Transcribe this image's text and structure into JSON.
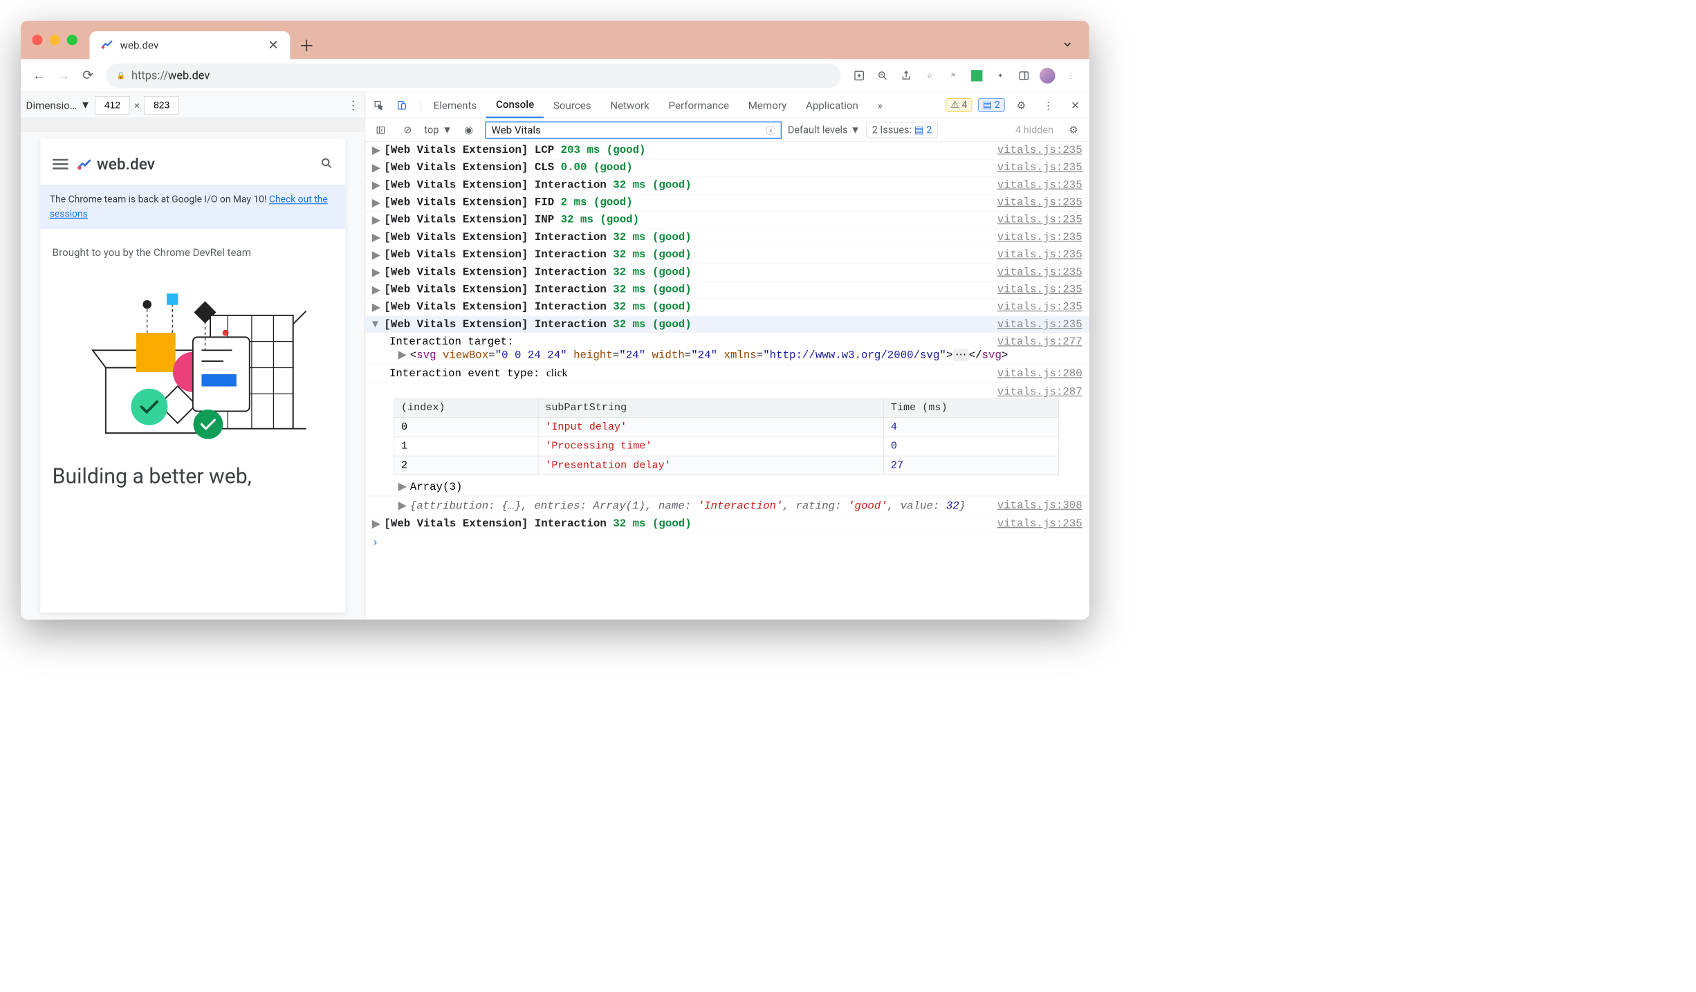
{
  "browser": {
    "tab_title": "web.dev",
    "url_scheme": "https://",
    "url_host": "web.dev",
    "dimensions_label": "Dimensio…",
    "width": "412",
    "height": "823"
  },
  "page": {
    "logo_text": "web.dev",
    "banner_text": "The Chrome team is back at Google I/O on May 10! ",
    "banner_link": "Check out the sessions",
    "subhead": "Brought to you by the Chrome DevRel team",
    "headline": "Building a better web,"
  },
  "devtools": {
    "tabs": [
      "Elements",
      "Console",
      "Sources",
      "Network",
      "Performance",
      "Memory",
      "Application"
    ],
    "active_tab": "Console",
    "warn_count": "4",
    "info_count": "2",
    "context": "top",
    "filter_value": "Web Vitals",
    "levels_label": "Default levels",
    "issues_label": "2 Issues:",
    "issues_count": "2",
    "hidden_label": "4 hidden"
  },
  "logs": [
    {
      "prefix": "[Web Vitals Extension]",
      "metric": "LCP",
      "value": "203 ms (good)",
      "src": "vitals.js:235"
    },
    {
      "prefix": "[Web Vitals Extension]",
      "metric": "CLS",
      "value": "0.00 (good)",
      "src": "vitals.js:235"
    },
    {
      "prefix": "[Web Vitals Extension]",
      "metric": "Interaction",
      "value": "32 ms (good)",
      "src": "vitals.js:235"
    },
    {
      "prefix": "[Web Vitals Extension]",
      "metric": "FID",
      "value": "2 ms (good)",
      "src": "vitals.js:235"
    },
    {
      "prefix": "[Web Vitals Extension]",
      "metric": "INP",
      "value": "32 ms (good)",
      "src": "vitals.js:235"
    },
    {
      "prefix": "[Web Vitals Extension]",
      "metric": "Interaction",
      "value": "32 ms (good)",
      "src": "vitals.js:235"
    },
    {
      "prefix": "[Web Vitals Extension]",
      "metric": "Interaction",
      "value": "32 ms (good)",
      "src": "vitals.js:235"
    },
    {
      "prefix": "[Web Vitals Extension]",
      "metric": "Interaction",
      "value": "32 ms (good)",
      "src": "vitals.js:235"
    },
    {
      "prefix": "[Web Vitals Extension]",
      "metric": "Interaction",
      "value": "32 ms (good)",
      "src": "vitals.js:235"
    },
    {
      "prefix": "[Web Vitals Extension]",
      "metric": "Interaction",
      "value": "32 ms (good)",
      "src": "vitals.js:235"
    }
  ],
  "expanded": {
    "head": {
      "prefix": "[Web Vitals Extension]",
      "metric": "Interaction",
      "value": "32 ms (good)",
      "src": "vitals.js:235"
    },
    "target_label": "Interaction target:",
    "target_src": "vitals.js:277",
    "svg_tag": "svg",
    "svg_attrs": [
      [
        "viewBox",
        "0 0 24 24"
      ],
      [
        "height",
        "24"
      ],
      [
        "width",
        "24"
      ],
      [
        "xmlns",
        "http://www.w3.org/2000/svg"
      ]
    ],
    "event_label": "Interaction event type: ",
    "event_value": "click",
    "event_src": "vitals.js:280",
    "table_src": "vitals.js:287",
    "table_headers": [
      "(index)",
      "subPartString",
      "Time (ms)"
    ],
    "table_rows": [
      [
        "0",
        "'Input delay'",
        "4"
      ],
      [
        "1",
        "'Processing time'",
        "0"
      ],
      [
        "2",
        "'Presentation delay'",
        "27"
      ]
    ],
    "array_label": "Array(3)",
    "attribution_text": "{attribution: {…}, entries: Array(1), name: 'Interaction', rating: 'good', value: 32}",
    "attribution_src": "vitals.js:308"
  },
  "final_log": {
    "prefix": "[Web Vitals Extension]",
    "metric": "Interaction",
    "value": "32 ms (good)",
    "src": "vitals.js:235"
  }
}
